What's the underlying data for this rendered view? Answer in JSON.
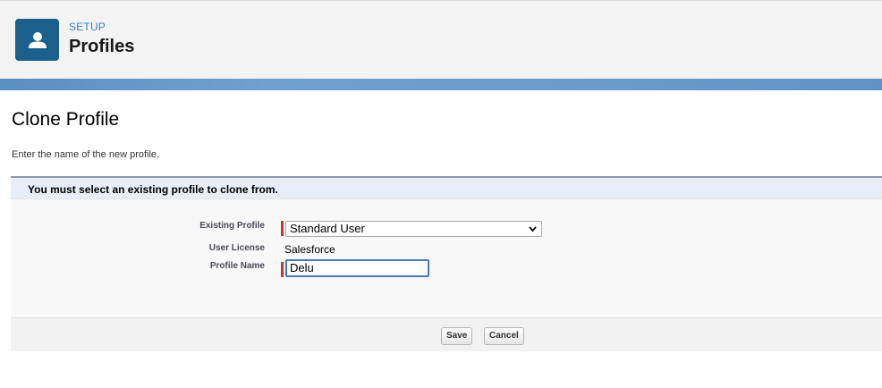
{
  "header": {
    "section": "SETUP",
    "title": "Profiles",
    "icon": "user-icon",
    "icon_bg": "#1b5f8c"
  },
  "main": {
    "title": "Clone Profile",
    "description": "Enter the name of the new profile.",
    "block_header": "You must select an existing profile to clone from.",
    "fields": {
      "existing_profile_label": "Existing Profile",
      "existing_profile_value": "Standard User",
      "user_license_label": "User License",
      "user_license_value": "Salesforce",
      "profile_name_label": "Profile Name",
      "profile_name_value": "Delu"
    },
    "buttons": {
      "save": "Save",
      "cancel": "Cancel"
    }
  }
}
